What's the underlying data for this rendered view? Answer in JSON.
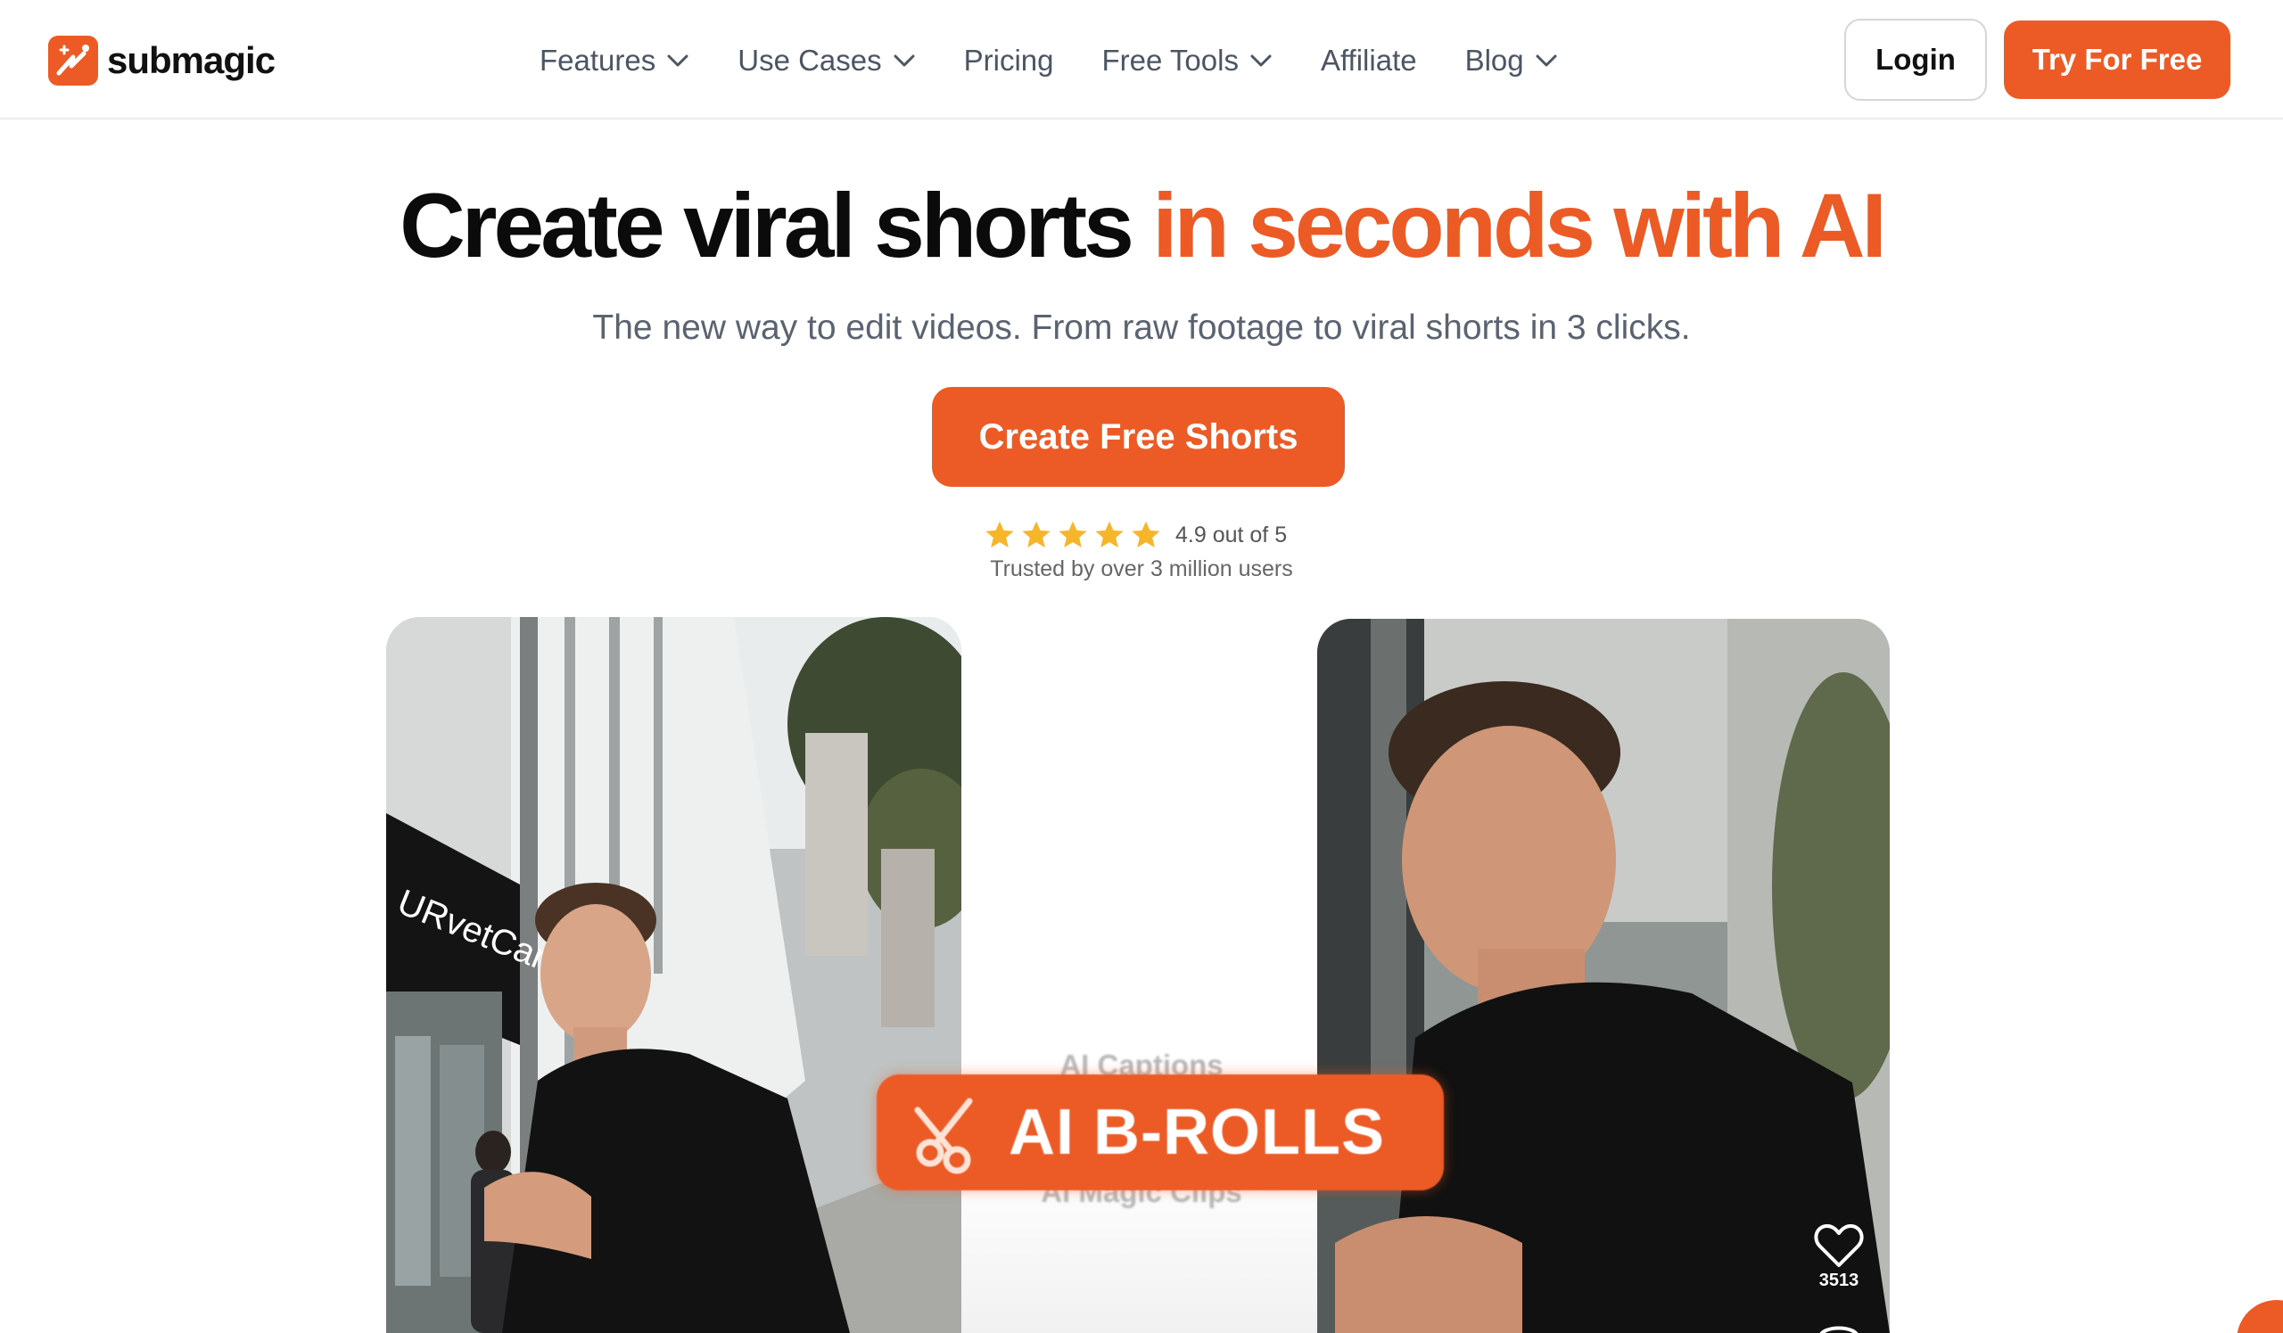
{
  "brand": {
    "name": "submagic",
    "accent": "#ec5b26"
  },
  "nav": {
    "items": [
      {
        "label": "Features",
        "dropdown": true
      },
      {
        "label": "Use Cases",
        "dropdown": true
      },
      {
        "label": "Pricing",
        "dropdown": false
      },
      {
        "label": "Free Tools",
        "dropdown": true
      },
      {
        "label": "Affiliate",
        "dropdown": false
      },
      {
        "label": "Blog",
        "dropdown": true
      }
    ],
    "login_label": "Login",
    "try_label": "Try For Free"
  },
  "hero": {
    "headline_dark": "Create viral shorts",
    "headline_accent": "in seconds with AI",
    "subtitle": "The new way to edit videos. From raw footage to viral shorts in 3 clicks.",
    "cta_label": "Create Free Shorts",
    "rating": {
      "stars": 5,
      "score_text": "4.9 out of 5"
    },
    "trusted_text": "Trusted by over 3 million users"
  },
  "demo": {
    "storefront_sign": "URvetCare",
    "caption_above": "AI Captions",
    "feature_pill": "AI B-ROLLS",
    "caption_below": "AI Magic Clips",
    "like_count": "3513"
  }
}
